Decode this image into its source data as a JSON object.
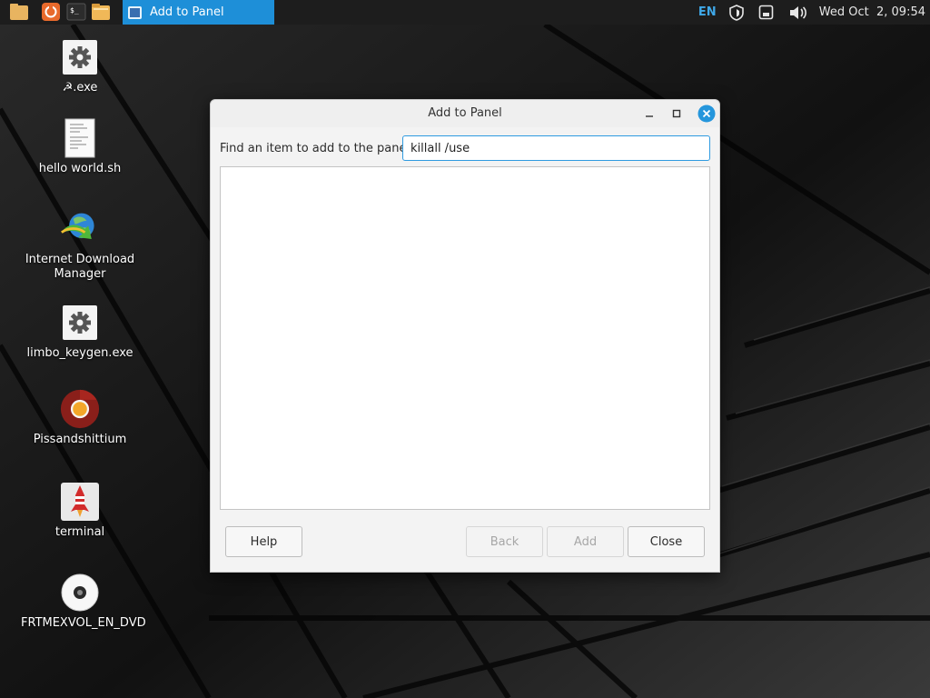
{
  "taskbar": {
    "active_task_label": "Add to Panel",
    "language": "EN",
    "clock": "Wed Oct  2, 09:54"
  },
  "desktop": {
    "icons": [
      {
        "label": ".exe",
        "prefix": "☭",
        "icon": "gear-icon"
      },
      {
        "label": "hello world.sh",
        "icon": "text-file-icon"
      },
      {
        "label": "Internet Download Manager",
        "icon": "idm-globe-icon"
      },
      {
        "label": "limbo_keygen.exe",
        "icon": "gear-icon"
      },
      {
        "label": "Pissandshittium",
        "icon": "chromium-icon"
      },
      {
        "label": "terminal",
        "icon": "rocket-icon"
      },
      {
        "label": "FRTMEXVOL_EN_DVD",
        "icon": "disc-icon"
      }
    ]
  },
  "dialog": {
    "title": "Add to Panel",
    "find_label": "Find an item to add to the panel:",
    "search_value": "killall /use",
    "results": [],
    "buttons": {
      "help": "Help",
      "back": "Back",
      "add": "Add",
      "close": "Close"
    }
  },
  "colors": {
    "accent": "#1e8fd8",
    "panel_bg": "#1d1d1d",
    "dialog_bg": "#f3f3f3"
  }
}
